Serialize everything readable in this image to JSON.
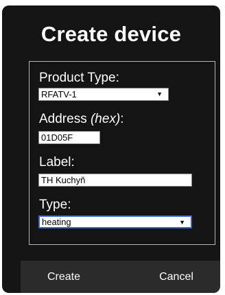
{
  "dialog": {
    "title": "Create device"
  },
  "form": {
    "product_type": {
      "label": "Product Type:",
      "value": "RFATV-1"
    },
    "address": {
      "label_main": "Address ",
      "label_hint": "(hex)",
      "label_suffix": ":",
      "value": "01D05F"
    },
    "label_field": {
      "label": "Label:",
      "value": "TH Kuchyň"
    },
    "type": {
      "label": "Type:",
      "value": "heating"
    }
  },
  "footer": {
    "create_label": "Create",
    "cancel_label": "Cancel"
  },
  "icons": {
    "dropdown_arrow": "▼"
  },
  "colors": {
    "dialog_background": "#141414",
    "footer_background": "#2b2b2b",
    "focus_border": "#3f61c8"
  }
}
